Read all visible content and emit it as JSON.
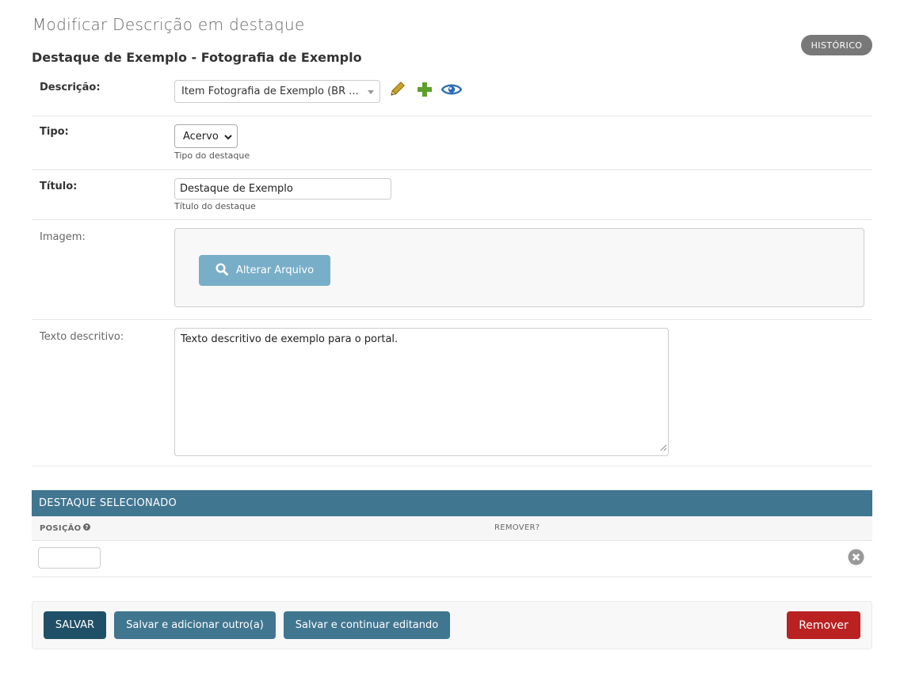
{
  "page": {
    "heading": "Modificar Descrição em destaque",
    "history_label": "HISTÓRICO",
    "object_title": "Destaque de Exemplo - Fotografia de Exemplo"
  },
  "form": {
    "descricao": {
      "label": "Descrição:",
      "value": "Item Fotografia de Exemplo (BR ...",
      "icons": [
        "pencil-icon",
        "plus-icon",
        "eye-icon"
      ]
    },
    "tipo": {
      "label": "Tipo:",
      "value": "Acervo",
      "help": "Tipo do destaque"
    },
    "titulo": {
      "label": "Título:",
      "value": "Destaque de Exemplo",
      "help": "Título do destaque"
    },
    "imagem": {
      "label": "Imagem:",
      "button_label": "Alterar Arquivo",
      "button_icon": "search-icon"
    },
    "texto": {
      "label": "Texto descritivo:",
      "value": "Texto descritivo de exemplo para o portal."
    }
  },
  "inline": {
    "title": "DESTAQUE SELECIONADO",
    "columns": {
      "position": "POSIÇÃO",
      "remove": "REMOVER?"
    },
    "rows": [
      {
        "position": ""
      }
    ]
  },
  "submit": {
    "save": "SALVAR",
    "save_add": "Salvar e adicionar outro(a)",
    "save_continue": "Salvar e continuar editando",
    "delete": "Remover"
  },
  "colors": {
    "header_bar": "#417690",
    "save_button": "#205067",
    "delete_button": "#ba2121",
    "pencil": "#b8860b",
    "plus": "#5ba02a",
    "eye": "#2e6db4"
  }
}
